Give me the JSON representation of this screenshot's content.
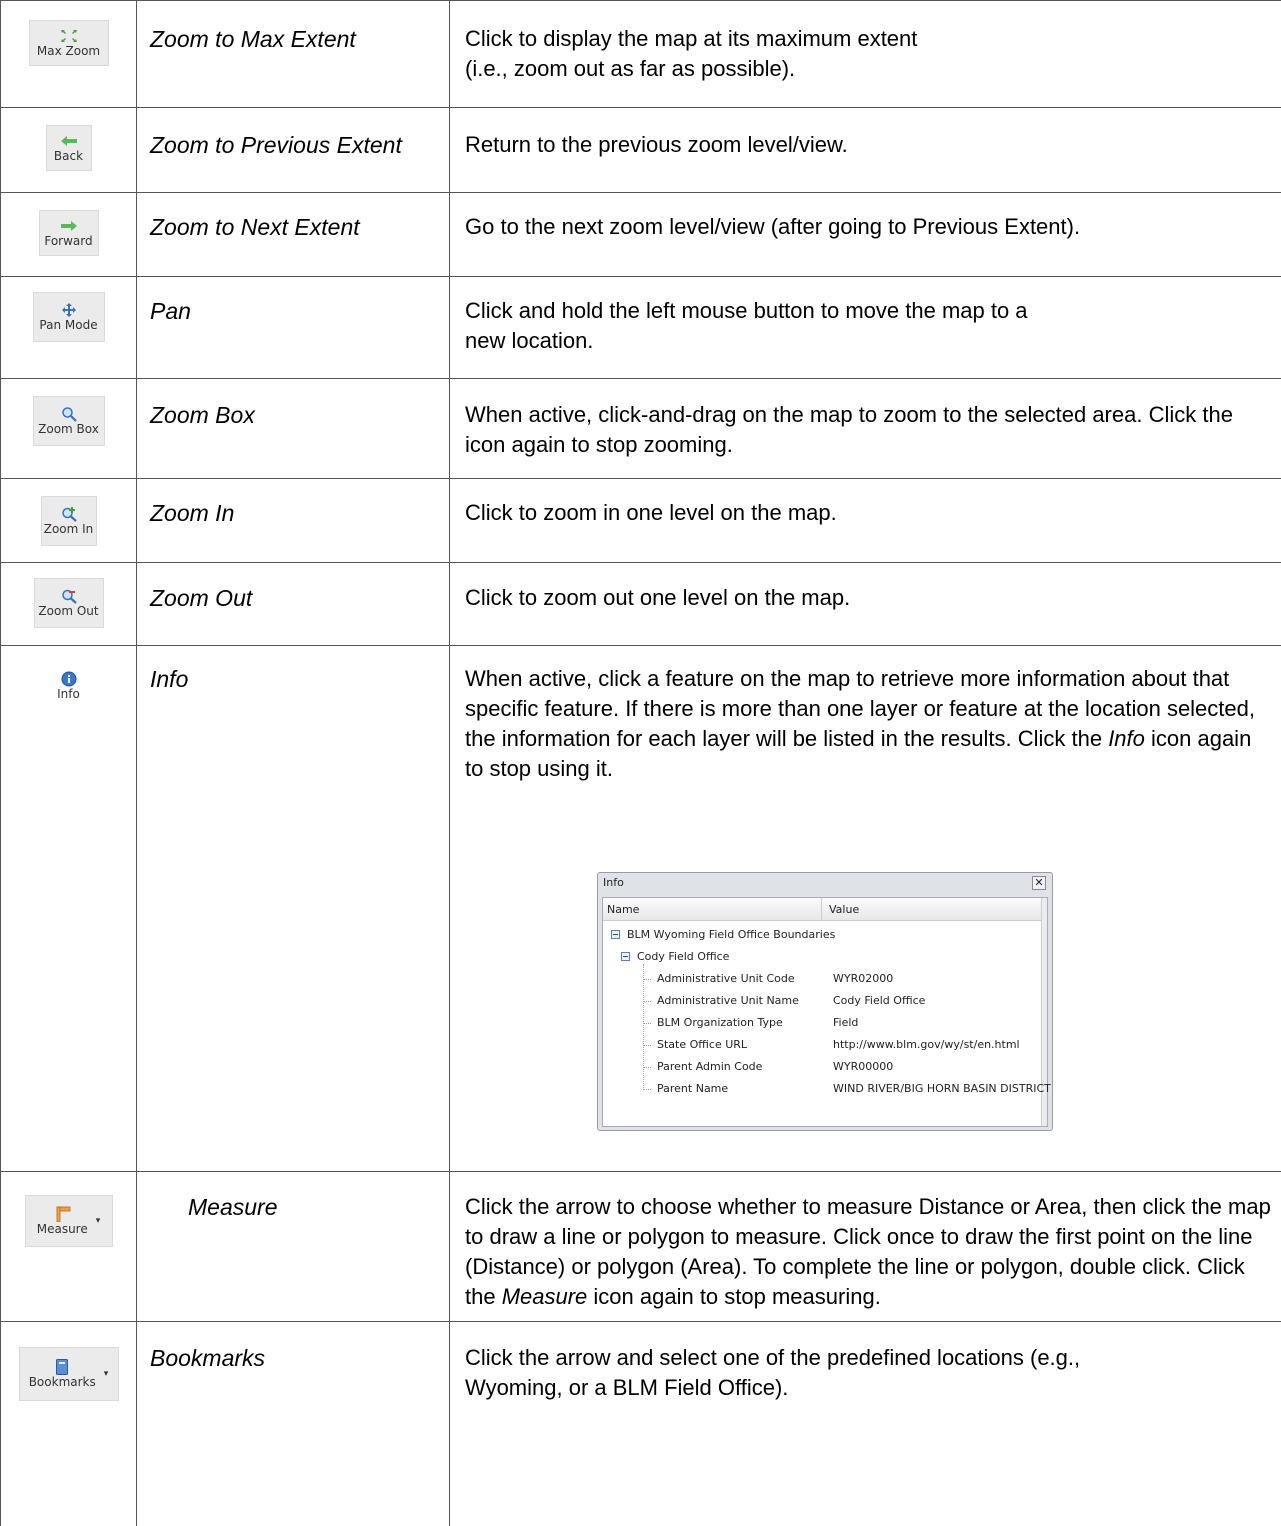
{
  "rows": [
    {
      "button": {
        "label": "Max Zoom",
        "icon": "max-zoom-icon"
      },
      "name": "Zoom to Max Extent",
      "description": [
        "Click to display the map at its maximum extent",
        "(i.e., zoom out as far as possible)."
      ]
    },
    {
      "button": {
        "label": "Back",
        "icon": "back-arrow-icon"
      },
      "name": "Zoom to Previous Extent",
      "description": "Return to the previous zoom level/view."
    },
    {
      "button": {
        "label": "Forward",
        "icon": "forward-arrow-icon"
      },
      "name": "Zoom to Next Extent",
      "description": "Go to the next zoom level/view (after going to Previous Extent)."
    },
    {
      "button": {
        "label": "Pan Mode",
        "icon": "pan-icon"
      },
      "name": "Pan",
      "description": [
        "Click and hold the left mouse button to move the map to a",
        "new location."
      ]
    },
    {
      "button": {
        "label": "Zoom Box",
        "icon": "zoom-box-icon"
      },
      "name": "Zoom Box",
      "description": "When active, click-and-drag on the map to zoom to the selected area. Click the icon again to stop zooming."
    },
    {
      "button": {
        "label": "Zoom In",
        "icon": "zoom-in-icon"
      },
      "name": "Zoom In",
      "description": "Click to zoom in one level on the map."
    },
    {
      "button": {
        "label": "Zoom Out",
        "icon": "zoom-out-icon"
      },
      "name": "Zoom Out",
      "description": "Click to zoom out one level on the map."
    },
    {
      "button": {
        "label": "Info",
        "icon": "info-icon"
      },
      "name": "Info",
      "description": {
        "before": "When active, click a feature on the map to retrieve more information about that specific feature.  If there is more than one layer or feature at the location selected, the information for each layer will be listed in the results. Click the ",
        "em": "Info",
        "after": " icon again to stop using it."
      }
    },
    {
      "button": {
        "label": "Measure",
        "icon": "measure-icon"
      },
      "name": "Measure",
      "description": {
        "before": "Click the arrow to choose whether to measure Distance or Area, then click the map to draw a line or polygon to measure.  Click once to draw the first point on the line (Distance) or polygon (Area).  To complete the line or  polygon, double click.  Click the ",
        "em": "Measure",
        "after": " icon again to stop measuring."
      }
    },
    {
      "button": {
        "label": "Bookmarks",
        "icon": "bookmark-icon"
      },
      "name": "Bookmarks",
      "description": [
        "Click the arrow and select one of the predefined locations (e.g.,",
        "Wyoming, or a BLM Field Office)."
      ]
    }
  ],
  "info_dialog": {
    "title": "Info",
    "close_glyph": "✕",
    "columns": [
      "Name",
      "Value"
    ],
    "layer": "BLM Wyoming Field Office Boundaries",
    "feature": "Cody Field Office",
    "attributes": [
      {
        "name": "Administrative Unit Code",
        "value": "WYR02000"
      },
      {
        "name": "Administrative Unit Name",
        "value": "Cody Field Office"
      },
      {
        "name": "BLM Organization Type",
        "value": "Field"
      },
      {
        "name": "State Office URL",
        "value": "http://www.blm.gov/wy/st/en.html"
      },
      {
        "name": "Parent Admin Code",
        "value": "WYR00000"
      },
      {
        "name": "Parent Name",
        "value": "WIND RIVER/BIG HORN BASIN DISTRICT"
      }
    ]
  },
  "colors": {
    "button_bg": "#ebebeb",
    "grid": "#555555",
    "dialog_frame": "#dfe3e8"
  }
}
